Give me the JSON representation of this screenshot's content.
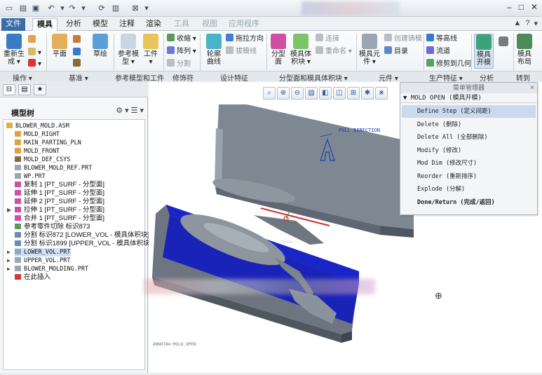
{
  "quick_access": {
    "new_icon": "new-file-icon",
    "open_icon": "open-folder-icon",
    "save_icon": "save-icon",
    "undo_icon": "undo-icon",
    "redo_icon": "redo-icon",
    "regenerate_icon": "regenerate-icon",
    "windows_icon": "windows-icon",
    "close_icon": "close-window-icon"
  },
  "tabs": [
    {
      "label": "文件",
      "state": "file"
    },
    {
      "label": "模具",
      "state": "active"
    },
    {
      "label": "分析",
      "state": "normal"
    },
    {
      "label": "模型",
      "state": "normal"
    },
    {
      "label": "注释",
      "state": "normal"
    },
    {
      "label": "渲染",
      "state": "normal"
    },
    {
      "label": "工具",
      "state": "faded"
    },
    {
      "label": "视图",
      "state": "faded"
    },
    {
      "label": "应用程序",
      "state": "faded"
    }
  ],
  "tab_right": [
    "▲",
    "?",
    "▾"
  ],
  "ribbon": {
    "big_buttons": [
      {
        "label": "重新生\n成 ▾",
        "icon": "regenerate-icon",
        "color": "#3a7bc8"
      },
      {
        "label": "平面",
        "icon": "datum-plane-icon",
        "color": "#e2b05a"
      },
      {
        "label": "草绘",
        "icon": "sketch-icon",
        "color": "#5a9fd8"
      },
      {
        "label": "参考模\n型 ▾",
        "icon": "reference-model-icon",
        "color": "#c9d6e2"
      },
      {
        "label": "工件\n▾",
        "icon": "workpiece-icon",
        "color": "#e7c45c"
      },
      {
        "label": "轮廓\n曲线",
        "icon": "silhouette-curve-icon",
        "color": "#49b3c9"
      },
      {
        "label": "分型\n面",
        "icon": "parting-surface-icon",
        "color": "#d04fa4"
      },
      {
        "label": "模具体\n积块 ▾",
        "icon": "mold-volume-icon",
        "color": "#7bc46a"
      },
      {
        "label": "模具元\n件 ▾",
        "icon": "mold-component-icon",
        "color": "#9aa6b2"
      },
      {
        "label": "模具\n开模",
        "icon": "mold-opening-icon",
        "color": "#3aa37c"
      },
      {
        "label": "模具\n布局",
        "icon": "mold-layout-icon",
        "color": "#4b8c5a"
      }
    ],
    "small_buttons": [
      {
        "label": "▾",
        "icon": "axis-icon",
        "dim": false
      },
      {
        "label": "▾",
        "icon": "delete-x-icon",
        "dim": false
      },
      {
        "label": "收缩 ▾",
        "icon": "shrink-icon",
        "dim": false
      },
      {
        "label": "阵列 ▾",
        "icon": "pattern-icon",
        "dim": false
      },
      {
        "label": "分割",
        "icon": "split-icon",
        "dim": true
      },
      {
        "label": "拖拉方向",
        "icon": "pull-direction-icon",
        "dim": false
      },
      {
        "label": "拔模线",
        "icon": "draft-line-icon",
        "dim": true
      },
      {
        "label": "连接",
        "icon": "connect-icon",
        "dim": true
      },
      {
        "label": "重命名 ▾",
        "icon": "rename-icon",
        "dim": true
      },
      {
        "label": "创建铸模",
        "icon": "create-casting-icon",
        "dim": true
      },
      {
        "label": "目录",
        "icon": "catalog-icon",
        "dim": false
      },
      {
        "label": "等高线",
        "icon": "waterline-icon",
        "dim": false
      },
      {
        "label": "流道",
        "icon": "runner-icon",
        "dim": false
      },
      {
        "label": "修剪到几何",
        "icon": "trim-to-geometry-icon",
        "dim": false
      }
    ],
    "groups": [
      "操作 ▾",
      "基准 ▾",
      "参考模型和工件",
      "修饰符",
      "设计特征",
      "分型面和模具体积块 ▾",
      "元件 ▾",
      "生产特征 ▾",
      "分析",
      "转到"
    ]
  },
  "left_panel": {
    "panel_tab_icons": [
      "model-tree-tab-icon",
      "folder-tab-icon",
      "favorites-tab-icon"
    ],
    "tree_title": "模型树",
    "tree_tools": [
      "settings-icon",
      "▾",
      "columns-icon",
      "▾"
    ],
    "items": [
      {
        "text": "BLOWER_MOLD.ASM",
        "icon": "assembly-icon",
        "level": 0,
        "expand": "",
        "cn": false,
        "sel": false
      },
      {
        "text": "MOLD_RIGHT",
        "icon": "datum-plane-icon",
        "level": 1,
        "expand": "",
        "cn": false,
        "sel": false
      },
      {
        "text": "MAIN_PARTING_PLN",
        "icon": "datum-plane-icon",
        "level": 1,
        "expand": "",
        "cn": false,
        "sel": false
      },
      {
        "text": "MOLD_FRONT",
        "icon": "datum-plane-icon",
        "level": 1,
        "expand": "",
        "cn": false,
        "sel": false
      },
      {
        "text": "MOLD_DEF_CSYS",
        "icon": "csys-icon",
        "level": 1,
        "expand": "",
        "cn": false,
        "sel": false
      },
      {
        "text": "BLOWER_MOLD_REF.PRT",
        "icon": "part-icon",
        "level": 1,
        "expand": "",
        "cn": false,
        "sel": false
      },
      {
        "text": "WP.PRT",
        "icon": "part-icon",
        "level": 1,
        "expand": "",
        "cn": false,
        "sel": false
      },
      {
        "text": "复制 1 [PT_SURF - 分型面]",
        "icon": "surface-icon",
        "level": 1,
        "expand": "",
        "cn": true,
        "sel": false
      },
      {
        "text": "延伸 1 [PT_SURF - 分型面]",
        "icon": "surface-icon",
        "level": 1,
        "expand": "",
        "cn": true,
        "sel": false
      },
      {
        "text": "延伸 2 [PT_SURF - 分型面]",
        "icon": "surface-icon",
        "level": 1,
        "expand": "",
        "cn": true,
        "sel": false
      },
      {
        "text": "拉伸 1 [PT_SURF - 分型面]",
        "icon": "surface-icon",
        "level": 1,
        "expand": "▶",
        "cn": true,
        "sel": false
      },
      {
        "text": "合并 1 [PT_SURF - 分型面]",
        "icon": "surface-icon",
        "level": 1,
        "expand": "",
        "cn": true,
        "sel": false
      },
      {
        "text": "参考零件切除 标识873",
        "icon": "cut-icon",
        "level": 1,
        "expand": "",
        "cn": true,
        "sel": false
      },
      {
        "text": "分割 标识872 [LOWER_VOL - 模具体积块]",
        "icon": "split-feature-icon",
        "level": 1,
        "expand": "",
        "cn": true,
        "sel": false
      },
      {
        "text": "分割 标识1899 [UPPER_VOL - 模具体积块]",
        "icon": "split-feature-icon",
        "level": 1,
        "expand": "",
        "cn": true,
        "sel": false
      },
      {
        "text": "LOWER_VOL.PRT",
        "icon": "part-icon",
        "level": 1,
        "expand": "▶",
        "cn": false,
        "sel": true
      },
      {
        "text": "UPPER_VOL.PRT",
        "icon": "part-icon",
        "level": 1,
        "expand": "▶",
        "cn": false,
        "sel": false
      },
      {
        "text": "BLOWER_MOLDING.PRT",
        "icon": "part-icon",
        "level": 1,
        "expand": "▶",
        "cn": false,
        "sel": false
      },
      {
        "text": "在此插入",
        "icon": "insert-here-icon",
        "level": 1,
        "expand": "",
        "cn": true,
        "sel": false
      }
    ]
  },
  "view_toolbar": [
    "zoom-fit-icon",
    "zoom-in-icon",
    "zoom-out-icon",
    "repaint-icon",
    "display-style-icon",
    "saved-views-icon",
    "datum-display-icon",
    "spin-center-icon",
    "annotation-display-icon"
  ],
  "graphics": {
    "pull_direction_label": "PULL DIRECTION",
    "coordinate_label": "ANNOT#4:MOLD_OPEN",
    "spin_icon": "spin-center-icon"
  },
  "menu_manager": {
    "title": "菜单管理器",
    "close": "×",
    "submenu": "▼ MOLD OPEN (模具开模)",
    "items": [
      {
        "label": "Define Step (定义间距)",
        "highlight": true,
        "bold": false
      },
      {
        "label": "Delete (删除)",
        "highlight": false,
        "bold": false
      },
      {
        "label": "Delete All (全部删除)",
        "highlight": false,
        "bold": false
      },
      {
        "label": "Modify (修改)",
        "highlight": false,
        "bold": false
      },
      {
        "label": "Mod Dim (修改尺寸)",
        "highlight": false,
        "bold": false
      },
      {
        "label": "Reorder (重新排序)",
        "highlight": false,
        "bold": false
      },
      {
        "label": "Explode (分解)",
        "highlight": false,
        "bold": false
      },
      {
        "label": "Done/Return (完成/返回)",
        "highlight": false,
        "bold": true
      }
    ]
  },
  "colors": {
    "mold_gray": "#7e8893",
    "cavity_blue": "#1a25c7",
    "accent": "#3a6da8"
  }
}
